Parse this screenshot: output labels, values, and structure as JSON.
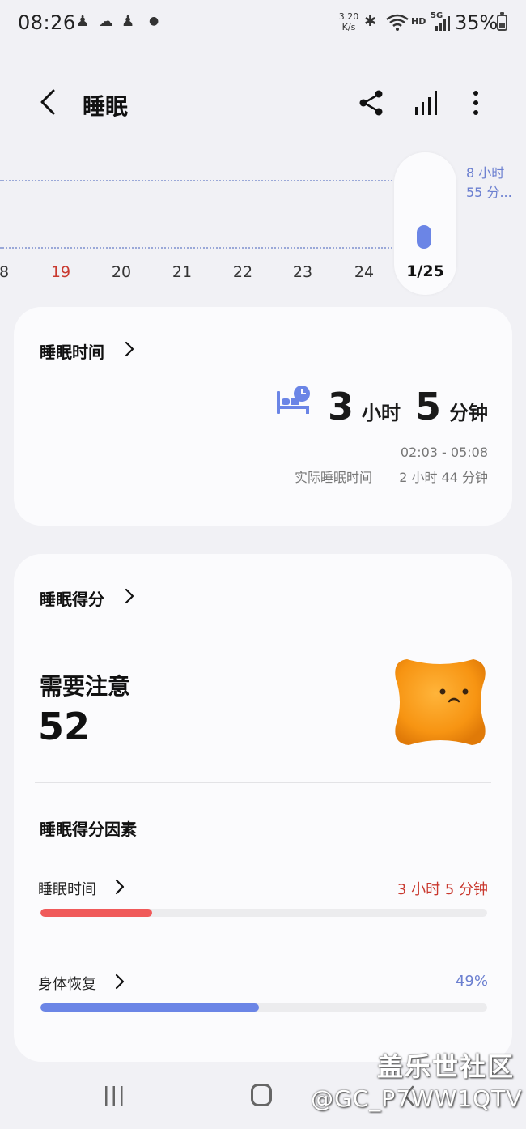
{
  "status_bar": {
    "time": "08:26",
    "net_speed_value": "3.20",
    "net_speed_unit": "K/s",
    "hd_label": "HD",
    "network_label": "5G",
    "battery_percent": "35%",
    "icons": [
      "notification-icon",
      "weather-icon",
      "notification-icon",
      "dot-icon",
      "bluetooth-icon",
      "wifi-icon",
      "signal-icon",
      "battery-icon"
    ]
  },
  "header": {
    "title": "睡眠"
  },
  "chart": {
    "max_label_line1": "8 小时",
    "max_label_line2": "55 分...",
    "days": [
      "8",
      "19",
      "20",
      "21",
      "22",
      "23",
      "24"
    ],
    "weekend_day": "19",
    "selected_date": "1/25",
    "selected_bar_color": "#6b85e6"
  },
  "sleep_time_card": {
    "heading": "睡眠时间",
    "hours": "3",
    "hours_unit": "小时",
    "minutes": "5",
    "minutes_unit": "分钟",
    "range": "02:03 - 05:08",
    "actual_label": "实际睡眠时间",
    "actual_value": "2 小时 44 分钟"
  },
  "score_card": {
    "heading": "睡眠得分",
    "status": "需要注意",
    "score": "52",
    "factors_title": "睡眠得分因素",
    "factors": [
      {
        "label": "睡眠时间",
        "value": "3 小时 5 分钟",
        "progress": 0.25,
        "color": "#f05a5a",
        "value_color": "#c9392f"
      },
      {
        "label": "身体恢复",
        "value": "49%",
        "progress": 0.49,
        "color": "#6b85e6",
        "value_color": "#6b7fd0"
      }
    ]
  },
  "watermark": {
    "site": "盖乐世社区",
    "user": "@GC_P7WW1QTV"
  }
}
